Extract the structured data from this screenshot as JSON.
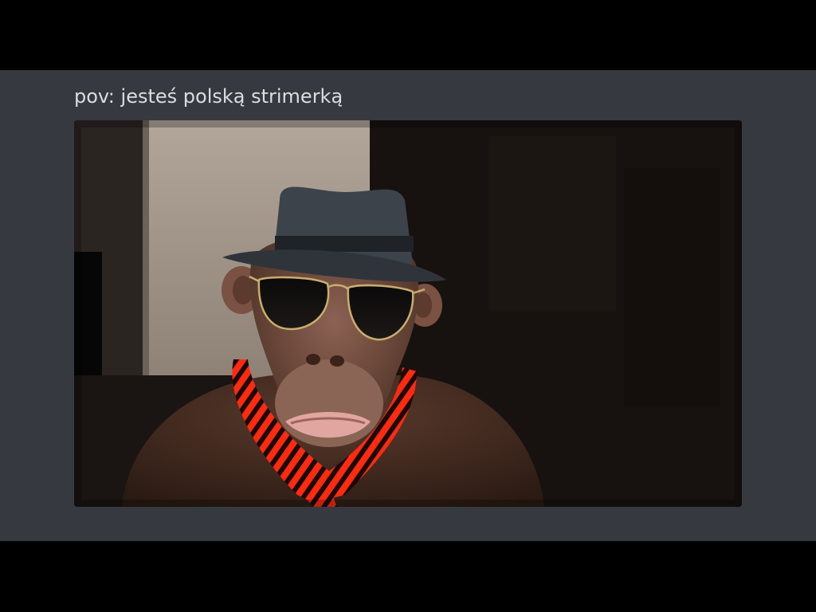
{
  "message": {
    "text": "pov: jesteś polską strimerką"
  },
  "attachment": {
    "type": "video-frame",
    "subject_icon": "chimp-with-hat-glasses-scarf"
  },
  "colors": {
    "letterbox": "#000000",
    "chat_background": "#36393f",
    "caption_text": "#dcddde",
    "scarf_red": "#ff2a0f",
    "scarf_dark": "#1a0807",
    "hat": "#3d434b"
  }
}
